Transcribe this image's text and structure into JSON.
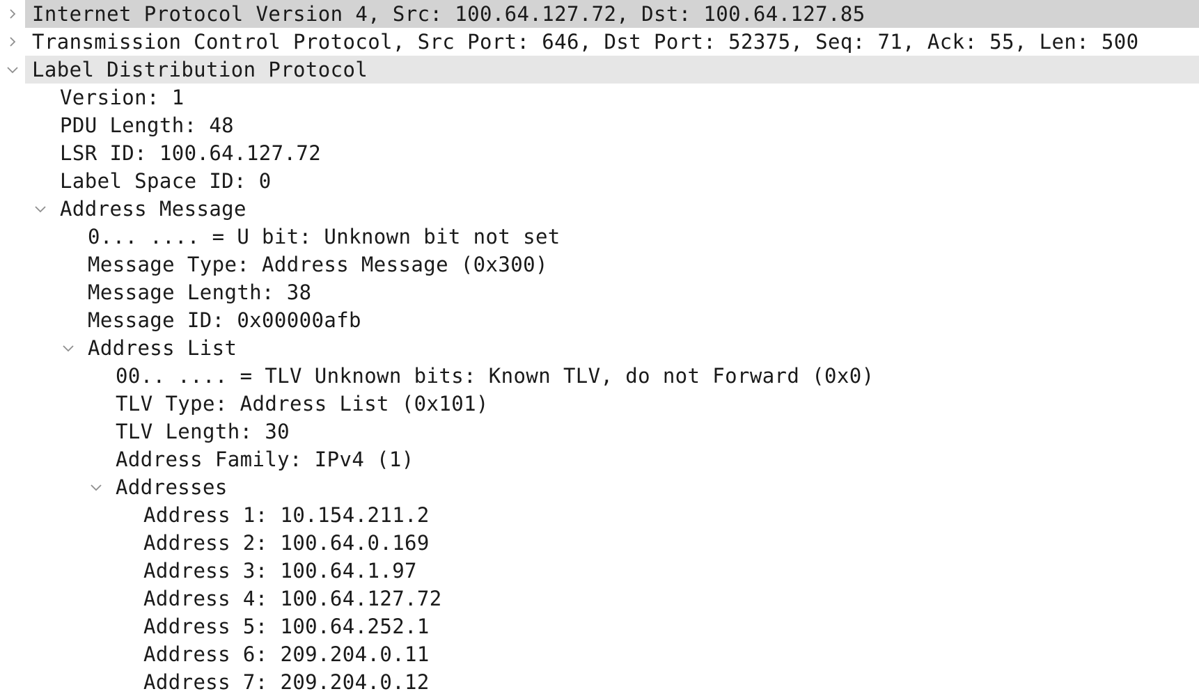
{
  "colors": {
    "row_highlight_dark": "#d3d3d3",
    "row_highlight_light": "#e6e6e6",
    "chevron": "#8e8e8e",
    "text": "#1a1a1a"
  },
  "tree": {
    "ip": "Internet Protocol Version 4, Src: 100.64.127.72, Dst: 100.64.127.85",
    "tcp": "Transmission Control Protocol, Src Port: 646, Dst Port: 52375, Seq: 71, Ack: 55, Len: 500",
    "ldp": {
      "label": "Label Distribution Protocol",
      "version": "Version: 1",
      "pdu_length": "PDU Length: 48",
      "lsr_id": "LSR ID: 100.64.127.72",
      "label_space_id": "Label Space ID: 0",
      "address_message": {
        "label": "Address Message",
        "u_bit": "0... .... = U bit: Unknown bit not set",
        "message_type": "Message Type: Address Message (0x300)",
        "message_length": "Message Length: 38",
        "message_id": "Message ID: 0x00000afb",
        "address_list": {
          "label": "Address List",
          "tlv_unknown_bits": "00.. .... = TLV Unknown bits: Known TLV, do not Forward (0x0)",
          "tlv_type": "TLV Type: Address List (0x101)",
          "tlv_length": "TLV Length: 30",
          "address_family": "Address Family: IPv4 (1)",
          "addresses": {
            "label": "Addresses",
            "items": [
              "Address 1: 10.154.211.2",
              "Address 2: 100.64.0.169",
              "Address 3: 100.64.1.97",
              "Address 4: 100.64.127.72",
              "Address 5: 100.64.252.1",
              "Address 6: 209.204.0.11",
              "Address 7: 209.204.0.12"
            ]
          }
        }
      }
    }
  }
}
